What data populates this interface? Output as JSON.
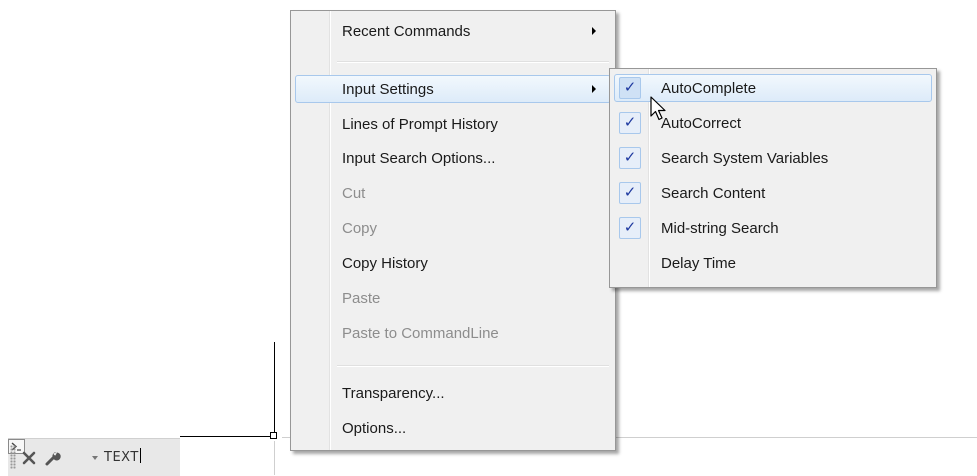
{
  "context_menu": {
    "items": [
      {
        "label": "Recent Commands",
        "submenu": true,
        "disabled": false
      },
      {
        "label": "Input Settings",
        "submenu": true,
        "disabled": false,
        "highlighted": true
      },
      {
        "label": "Lines of Prompt History",
        "disabled": false
      },
      {
        "label": "Input Search Options...",
        "disabled": false
      },
      {
        "label": "Cut",
        "disabled": true
      },
      {
        "label": "Copy",
        "disabled": true
      },
      {
        "label": "Copy History",
        "disabled": false
      },
      {
        "label": "Paste",
        "disabled": true
      },
      {
        "label": "Paste to CommandLine",
        "disabled": true
      },
      {
        "label": "Transparency...",
        "disabled": false
      },
      {
        "label": "Options...",
        "disabled": false
      }
    ]
  },
  "input_settings_submenu": {
    "items": [
      {
        "label": "AutoComplete",
        "checked": true,
        "highlighted": true
      },
      {
        "label": "AutoCorrect",
        "checked": true
      },
      {
        "label": "Search System Variables",
        "checked": true
      },
      {
        "label": "Search Content",
        "checked": true
      },
      {
        "label": "Mid-string Search",
        "checked": true
      },
      {
        "label": "Delay Time",
        "checked": false
      }
    ],
    "check_glyph": "✓"
  },
  "command_line": {
    "input_value": "TEXT",
    "icons": [
      "grip-icon",
      "close-icon",
      "wrench-icon",
      "command-prompt-icon",
      "dropdown-arrow-icon"
    ]
  },
  "colors": {
    "highlight_border": "#a8c8ec",
    "menu_bg": "#f0f0f0",
    "check_color": "#1f3aa0",
    "disabled_text": "#8d8d8d"
  }
}
